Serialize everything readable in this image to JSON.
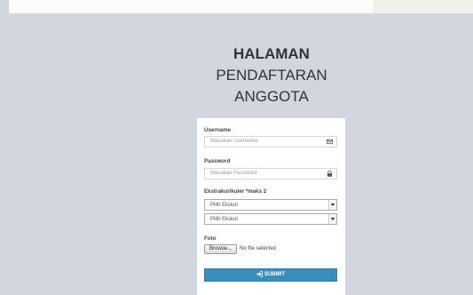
{
  "page": {
    "title_line1": "HALAMAN",
    "title_line2": "PENDAFTARAN",
    "title_line3": "ANGGOTA"
  },
  "form": {
    "username_label": "Username",
    "username_placeholder": "Masukan Username",
    "username_icon": "envelope-icon",
    "password_label": "Password",
    "password_placeholder": "Masukan Password",
    "password_icon": "lock-icon",
    "ekskul_label": "Ekstrakurikuler *maks 2",
    "ekskul_select_1": "Pilih Ekskul",
    "ekskul_select_2": "Pilih Ekskul",
    "foto_label": "Foto",
    "browse_label": "Browse...",
    "file_status": "No file selected",
    "submit_label": "SUBMIT",
    "submit_icon": "sign-in-icon"
  },
  "colors": {
    "background": "#d2d6de",
    "panel": "#ffffff",
    "submit": "#3c8dbc"
  }
}
